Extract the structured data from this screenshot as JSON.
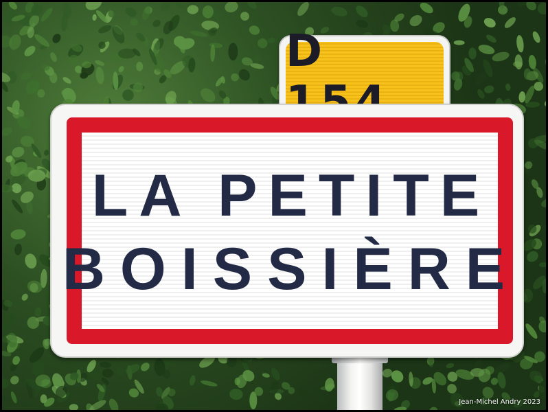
{
  "route_sign": {
    "label": "D 154",
    "color": "#f8c21c"
  },
  "town_sign": {
    "line1": "LA PETITE",
    "line2": "BOISSIÈRE",
    "border_color": "#d9182a",
    "text_color": "#232a45"
  },
  "watermark": "Jean-Michel Andry 2023"
}
